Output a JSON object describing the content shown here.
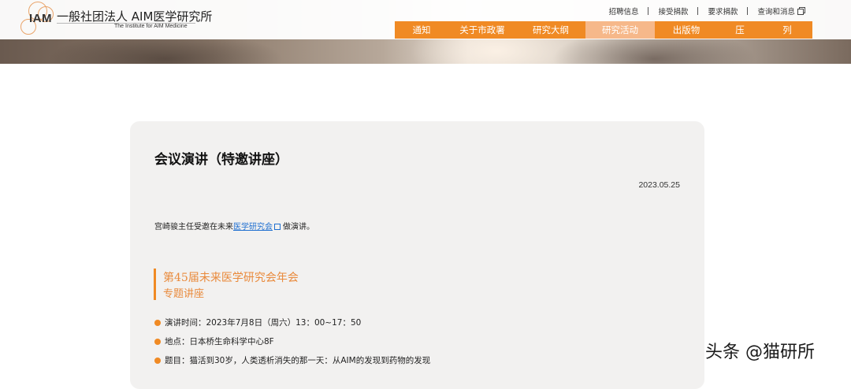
{
  "header": {
    "logo_text": "IAM",
    "org_name": "一般社团法人 AIM医学研究所",
    "org_name_en": "The Institute for AIM Medicine",
    "utility_links": [
      {
        "label": "招聘信息"
      },
      {
        "label": "接受捐款"
      },
      {
        "label": "要求捐款"
      },
      {
        "label": "查询和消息"
      }
    ],
    "nav": [
      {
        "label": "通知"
      },
      {
        "label": "关于市政署"
      },
      {
        "label": "研究大纲"
      },
      {
        "label": "研究活动",
        "active": true
      },
      {
        "label": "出版物"
      },
      {
        "label": "压"
      },
      {
        "label": "列"
      }
    ],
    "accent_color": "#f08a24"
  },
  "article": {
    "title": "会议演讲（特邀讲座）",
    "date": "2023.05.25",
    "intro_before": "宫崎骏主任受邀在未来",
    "intro_link": "医学研究会",
    "intro_after": "做演讲。",
    "event_name": "第45届未来医学研究会年会",
    "event_sub": "专题讲座",
    "details": [
      {
        "text": "演讲时间：2023年7月8日（周六）13：00~17：50"
      },
      {
        "text": "地点：日本桥生命科学中心8F"
      },
      {
        "text": "题目：猫活到30岁，人类透析消失的那一天：从AIM的发现到药物的发现"
      }
    ]
  },
  "watermark": "头条 @猫研所"
}
